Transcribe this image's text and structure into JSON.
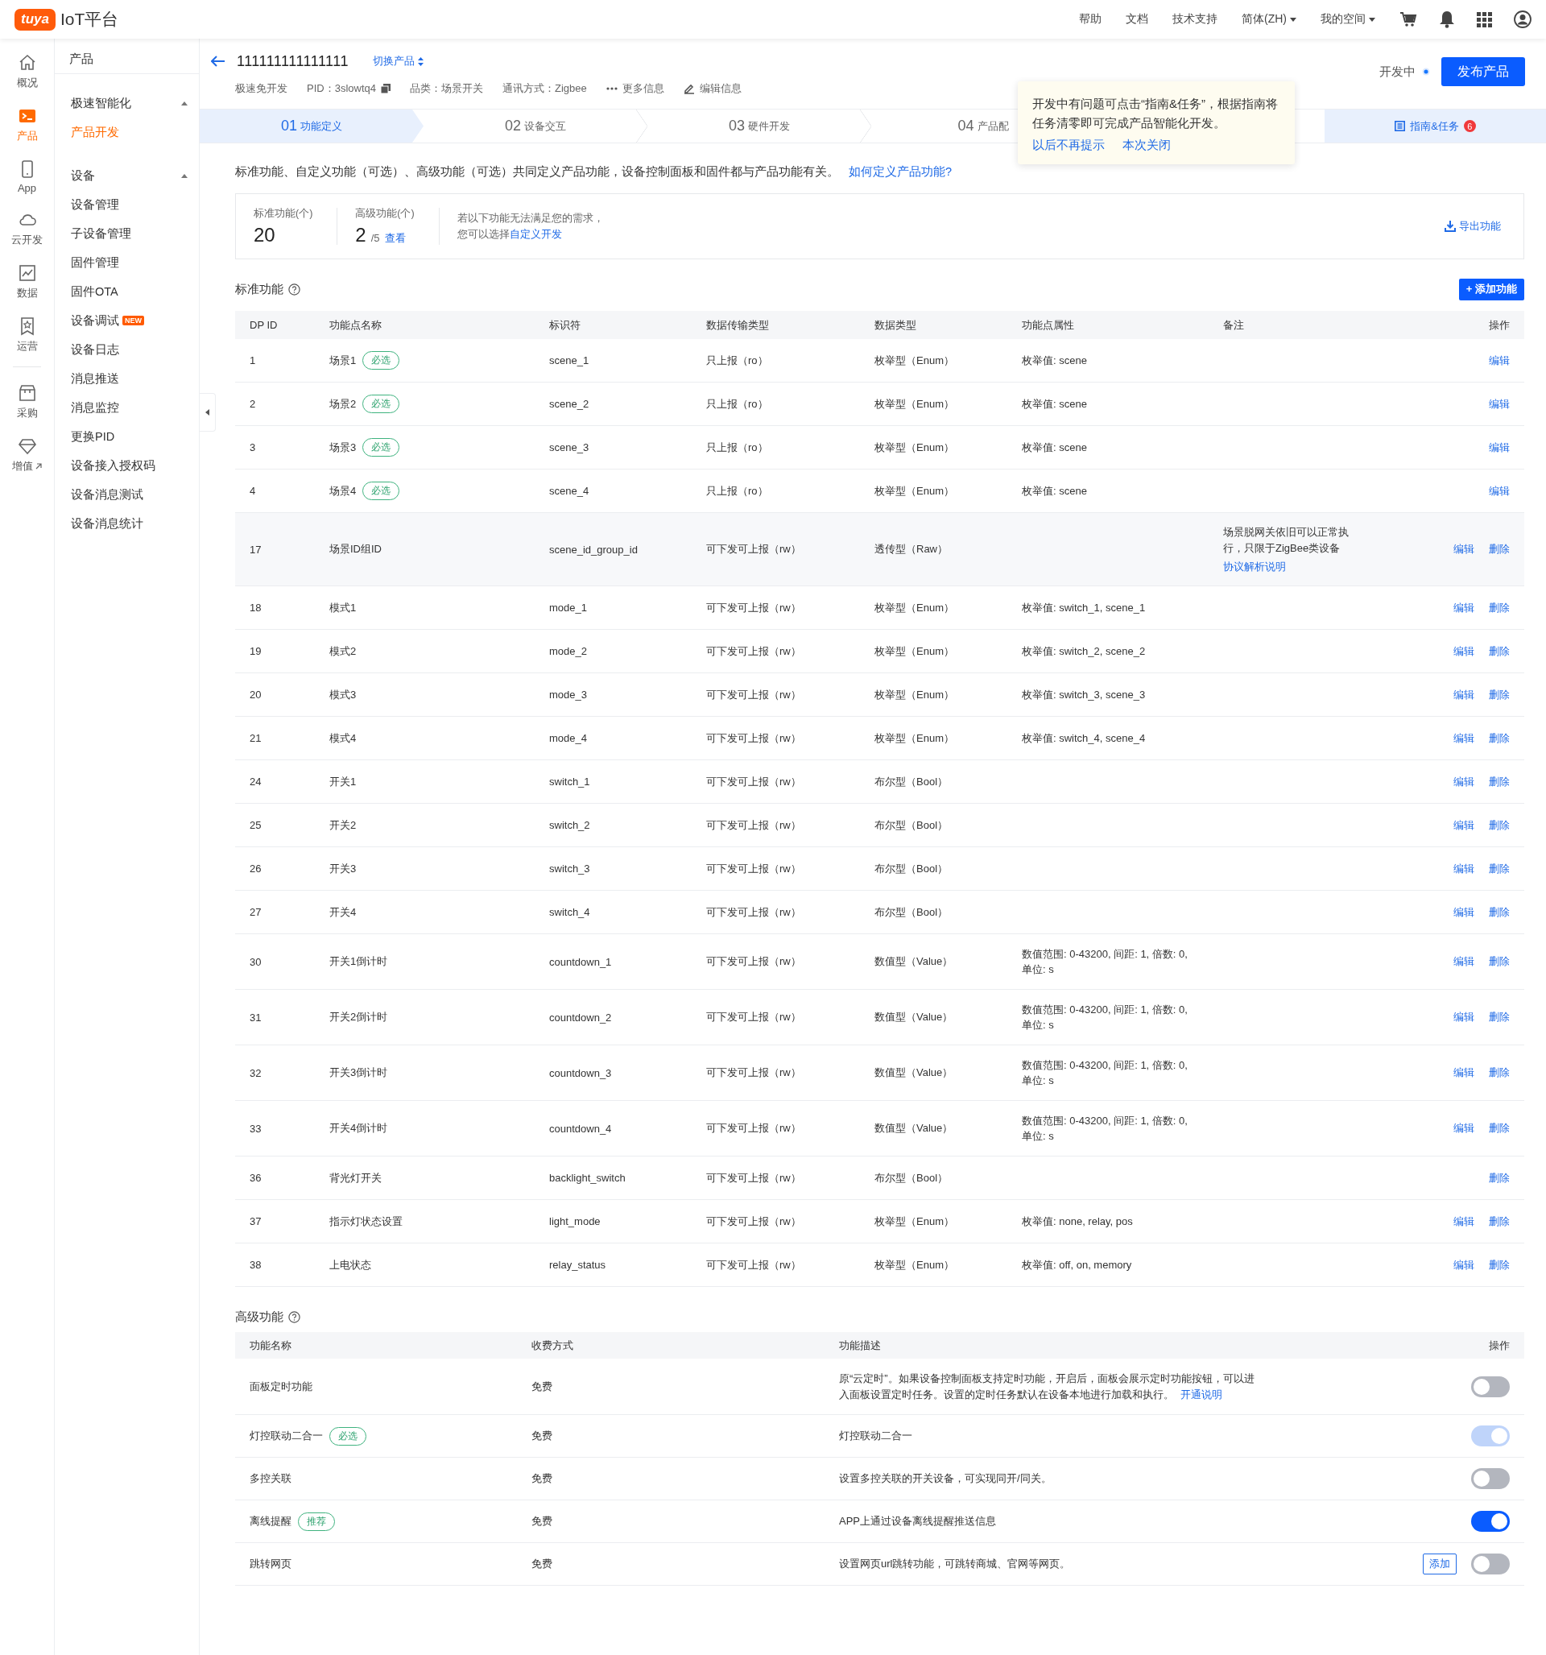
{
  "header": {
    "logo_badge": "tuya",
    "logo_text": "IoT平台",
    "links": [
      {
        "label": "帮助",
        "dropdown": false
      },
      {
        "label": "文档",
        "dropdown": false
      },
      {
        "label": "技术支持",
        "dropdown": false
      },
      {
        "label": "简体(ZH)",
        "dropdown": true
      },
      {
        "label": "我的空间",
        "dropdown": true
      }
    ]
  },
  "rail": [
    {
      "kind": "home",
      "label": "概况",
      "selected": false,
      "external": false
    },
    {
      "kind": "product",
      "label": "产品",
      "selected": true,
      "external": false
    },
    {
      "kind": "app",
      "label": "App",
      "selected": false,
      "external": false
    },
    {
      "kind": "cloud",
      "label": "云开发",
      "selected": false,
      "external": false
    },
    {
      "kind": "data",
      "label": "数据",
      "selected": false,
      "external": false
    },
    {
      "kind": "ops",
      "label": "运营",
      "selected": false,
      "external": false
    },
    {
      "kind": "purchase",
      "label": "采购",
      "selected": false,
      "external": false
    },
    {
      "kind": "value",
      "label": "增值",
      "selected": false,
      "external": true
    }
  ],
  "sidebar": {
    "title": "产品",
    "groups": [
      {
        "label": "极速智能化",
        "expanded": true,
        "items": [
          {
            "label": "产品开发",
            "selected": true
          }
        ]
      },
      {
        "label": "设备",
        "expanded": true,
        "items": [
          {
            "label": "设备管理",
            "selected": false
          },
          {
            "label": "子设备管理",
            "selected": false
          },
          {
            "label": "固件管理",
            "selected": false
          },
          {
            "label": "固件OTA",
            "selected": false
          },
          {
            "label": "设备调试",
            "selected": false,
            "badge": "NEW"
          },
          {
            "label": "设备日志",
            "selected": false
          },
          {
            "label": "消息推送",
            "selected": false
          },
          {
            "label": "消息监控",
            "selected": false
          },
          {
            "label": "更换PID",
            "selected": false
          },
          {
            "label": "设备接入授权码",
            "selected": false
          },
          {
            "label": "设备消息测试",
            "selected": false
          },
          {
            "label": "设备消息统计",
            "selected": false
          }
        ]
      }
    ]
  },
  "product": {
    "name": "111111111111111",
    "switch_label": "切换产品",
    "meta": [
      {
        "kind": "text",
        "text": "极速免开发"
      },
      {
        "kind": "copy",
        "text": "PID：3slowtq4"
      },
      {
        "kind": "text",
        "text": "品类：场景开关"
      },
      {
        "kind": "text",
        "text": "通讯方式：Zigbee"
      },
      {
        "kind": "more",
        "text": "更多信息"
      },
      {
        "kind": "edit",
        "text": "编辑信息"
      }
    ],
    "status": "开发中",
    "publish": "发布产品"
  },
  "steps": [
    {
      "number": "01",
      "label": "功能定义",
      "selected": true
    },
    {
      "number": "02",
      "label": "设备交互",
      "selected": false
    },
    {
      "number": "03",
      "label": "硬件开发",
      "selected": false
    },
    {
      "number": "04",
      "label": "产品配",
      "selected": false
    }
  ],
  "guide": {
    "label": "指南&任务",
    "badge": "6"
  },
  "popover": {
    "text": "开发中有问题可点击“指南&任务”，根据指南将任务清零即可完成产品智能化开发。",
    "links": [
      "以后不再提示",
      "本次关闭"
    ]
  },
  "intro": {
    "text": "标准功能、自定义功能（可选）、高级功能（可选）共同定义产品功能，设备控制面板和固件都与产品功能有关。",
    "link": "如何定义产品功能?"
  },
  "summary": {
    "standard_label": "标准功能(个)",
    "standard_value": "20",
    "advanced_label": "高级功能(个)",
    "advanced_value": "2",
    "advanced_total": "/5",
    "advanced_link": "查看",
    "hint": "若以下功能无法满足您的需求，",
    "hint_prefix": "您可以选择",
    "hint_link": "自定义开发",
    "export": "导出功能"
  },
  "standard": {
    "title": "标准功能",
    "add": "+ 添加功能",
    "columns": [
      "DP ID",
      "功能点名称",
      "标识符",
      "数据传输类型",
      "数据类型",
      "功能点属性",
      "备注",
      "操作"
    ],
    "rows": [
      {
        "dp": "1",
        "name": "场景1",
        "tag": "必选",
        "code": "scene_1",
        "mode": "只上报（ro）",
        "type": "枚举型（Enum）",
        "props": "枚举值: scene",
        "highlighted": false,
        "actions": [
          "编辑"
        ]
      },
      {
        "dp": "2",
        "name": "场景2",
        "tag": "必选",
        "code": "scene_2",
        "mode": "只上报（ro）",
        "type": "枚举型（Enum）",
        "props": "枚举值: scene",
        "highlighted": false,
        "actions": [
          "编辑"
        ]
      },
      {
        "dp": "3",
        "name": "场景3",
        "tag": "必选",
        "code": "scene_3",
        "mode": "只上报（ro）",
        "type": "枚举型（Enum）",
        "props": "枚举值: scene",
        "highlighted": false,
        "actions": [
          "编辑"
        ]
      },
      {
        "dp": "4",
        "name": "场景4",
        "tag": "必选",
        "code": "scene_4",
        "mode": "只上报（ro）",
        "type": "枚举型（Enum）",
        "props": "枚举值: scene",
        "highlighted": false,
        "actions": [
          "编辑"
        ]
      },
      {
        "dp": "17",
        "name": "场景ID组ID",
        "code": "scene_id_group_id",
        "mode": "可下发可上报（rw）",
        "type": "透传型（Raw）",
        "note": "场景脱网关依旧可以正常执行，只限于ZigBee类设备",
        "note_link": "协议解析说明",
        "highlighted": true,
        "actions": [
          "编辑",
          "删除"
        ]
      },
      {
        "dp": "18",
        "name": "模式1",
        "code": "mode_1",
        "mode": "可下发可上报（rw）",
        "type": "枚举型（Enum）",
        "props": "枚举值: switch_1, scene_1",
        "highlighted": false,
        "actions": [
          "编辑",
          "删除"
        ]
      },
      {
        "dp": "19",
        "name": "模式2",
        "code": "mode_2",
        "mode": "可下发可上报（rw）",
        "type": "枚举型（Enum）",
        "props": "枚举值: switch_2, scene_2",
        "highlighted": false,
        "actions": [
          "编辑",
          "删除"
        ]
      },
      {
        "dp": "20",
        "name": "模式3",
        "code": "mode_3",
        "mode": "可下发可上报（rw）",
        "type": "枚举型（Enum）",
        "props": "枚举值: switch_3, scene_3",
        "highlighted": false,
        "actions": [
          "编辑",
          "删除"
        ]
      },
      {
        "dp": "21",
        "name": "模式4",
        "code": "mode_4",
        "mode": "可下发可上报（rw）",
        "type": "枚举型（Enum）",
        "props": "枚举值: switch_4, scene_4",
        "highlighted": false,
        "actions": [
          "编辑",
          "删除"
        ]
      },
      {
        "dp": "24",
        "name": "开关1",
        "code": "switch_1",
        "mode": "可下发可上报（rw）",
        "type": "布尔型（Bool）",
        "highlighted": false,
        "actions": [
          "编辑",
          "删除"
        ]
      },
      {
        "dp": "25",
        "name": "开关2",
        "code": "switch_2",
        "mode": "可下发可上报（rw）",
        "type": "布尔型（Bool）",
        "highlighted": false,
        "actions": [
          "编辑",
          "删除"
        ]
      },
      {
        "dp": "26",
        "name": "开关3",
        "code": "switch_3",
        "mode": "可下发可上报（rw）",
        "type": "布尔型（Bool）",
        "highlighted": false,
        "actions": [
          "编辑",
          "删除"
        ]
      },
      {
        "dp": "27",
        "name": "开关4",
        "code": "switch_4",
        "mode": "可下发可上报（rw）",
        "type": "布尔型（Bool）",
        "highlighted": false,
        "actions": [
          "编辑",
          "删除"
        ]
      },
      {
        "dp": "30",
        "name": "开关1倒计时",
        "code": "countdown_1",
        "mode": "可下发可上报（rw）",
        "type": "数值型（Value）",
        "props": "数值范围: 0-43200, 间距: 1, 倍数: 0, 单位: s",
        "highlighted": false,
        "actions": [
          "编辑",
          "删除"
        ]
      },
      {
        "dp": "31",
        "name": "开关2倒计时",
        "code": "countdown_2",
        "mode": "可下发可上报（rw）",
        "type": "数值型（Value）",
        "props": "数值范围: 0-43200, 间距: 1, 倍数: 0, 单位: s",
        "highlighted": false,
        "actions": [
          "编辑",
          "删除"
        ]
      },
      {
        "dp": "32",
        "name": "开关3倒计时",
        "code": "countdown_3",
        "mode": "可下发可上报（rw）",
        "type": "数值型（Value）",
        "props": "数值范围: 0-43200, 间距: 1, 倍数: 0, 单位: s",
        "highlighted": false,
        "actions": [
          "编辑",
          "删除"
        ]
      },
      {
        "dp": "33",
        "name": "开关4倒计时",
        "code": "countdown_4",
        "mode": "可下发可上报（rw）",
        "type": "数值型（Value）",
        "props": "数值范围: 0-43200, 间距: 1, 倍数: 0, 单位: s",
        "highlighted": false,
        "actions": [
          "编辑",
          "删除"
        ]
      },
      {
        "dp": "36",
        "name": "背光灯开关",
        "code": "backlight_switch",
        "mode": "可下发可上报（rw）",
        "type": "布尔型（Bool）",
        "highlighted": false,
        "actions": [
          "删除"
        ]
      },
      {
        "dp": "37",
        "name": "指示灯状态设置",
        "code": "light_mode",
        "mode": "可下发可上报（rw）",
        "type": "枚举型（Enum）",
        "props": "枚举值: none, relay, pos",
        "highlighted": false,
        "actions": [
          "编辑",
          "删除"
        ]
      },
      {
        "dp": "38",
        "name": "上电状态",
        "code": "relay_status",
        "mode": "可下发可上报（rw）",
        "type": "枚举型（Enum）",
        "props": "枚举值: off, on, memory",
        "highlighted": false,
        "actions": [
          "编辑",
          "删除"
        ]
      }
    ]
  },
  "advanced": {
    "title": "高级功能",
    "columns": [
      "功能名称",
      "收费方式",
      "功能描述",
      "操作"
    ],
    "rows": [
      {
        "name": "面板定时功能",
        "fee": "免费",
        "desc": "原“云定时”。如果设备控制面板支持定时功能，开启后，面板会展示定时功能按钮，可以进入面板设置定时任务。设置的定时任务默认在设备本地进行加载和执行。",
        "desc_link": "开通说明",
        "on": false,
        "disabled": false
      },
      {
        "name": "灯控联动二合一",
        "tag": "必选",
        "fee": "免费",
        "desc": "灯控联动二合一",
        "on": true,
        "disabled": true
      },
      {
        "name": "多控关联",
        "fee": "免费",
        "desc": "设置多控关联的开关设备，可实现同开/同关。",
        "on": false,
        "disabled": false
      },
      {
        "name": "离线提醒",
        "tag": "推荐",
        "fee": "免费",
        "desc": "APP上通过设备离线提醒推送信息",
        "on": true,
        "disabled": false
      },
      {
        "name": "跳转网页",
        "fee": "免费",
        "desc": "设置网页url跳转功能，可跳转商城、官网等网页。",
        "add": "添加",
        "on": false,
        "disabled": false
      }
    ]
  }
}
